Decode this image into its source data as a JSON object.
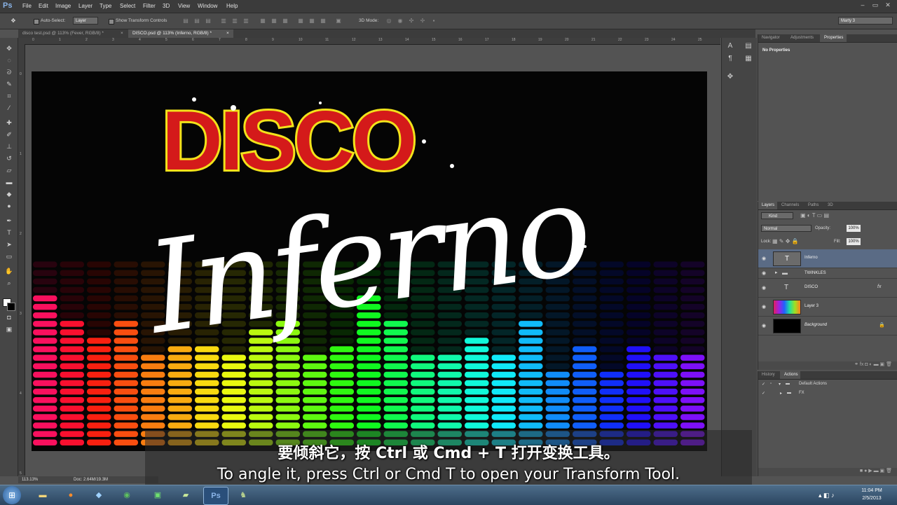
{
  "app": {
    "logo": "Ps"
  },
  "menu": [
    "File",
    "Edit",
    "Image",
    "Layer",
    "Type",
    "Select",
    "Filter",
    "3D",
    "View",
    "Window",
    "Help"
  ],
  "window_controls": [
    "–",
    "▭",
    "✕"
  ],
  "options_bar": {
    "auto_select_label": "Auto-Select:",
    "auto_select_value": "Layer",
    "show_transform_label": "Show Transform Controls",
    "mode_3d_label": "3D Mode:",
    "workspace_value": "Marty 3"
  },
  "doc_tabs": [
    {
      "label": "disco test.psd @ 113% (Fever, RGB/8) *",
      "active": false
    },
    {
      "label": "DISCO.psd @ 113% (Inferno, RGB/8) *",
      "active": true
    }
  ],
  "tab_close": "×",
  "ruler_top_ticks": [
    "0",
    "1",
    "2",
    "3",
    "4",
    "5",
    "6",
    "7",
    "8",
    "9",
    "10",
    "11",
    "12",
    "13",
    "14",
    "15",
    "16",
    "17",
    "18",
    "19",
    "20",
    "21",
    "22",
    "23",
    "24",
    "25"
  ],
  "ruler_left_ticks": [
    "0",
    "1",
    "2",
    "3",
    "4",
    "5"
  ],
  "canvas": {
    "title_word": "DISCO",
    "script_word": "Inferno",
    "colors": {
      "disco_fill": "#d41a1a",
      "disco_stroke": "#f2e21a",
      "script_fill": "#ffffff"
    }
  },
  "properties_panel": {
    "tabs": [
      "Navigator",
      "Adjustments",
      "Properties"
    ],
    "active_tab": "Properties",
    "content": "No Properties"
  },
  "layers_panel": {
    "tabs": [
      "Layers",
      "Channels",
      "Paths",
      "3D"
    ],
    "active_tab": "Layers",
    "kind_label": "Kind",
    "blend_mode": "Normal",
    "opacity_label": "Opacity:",
    "opacity_value": "100%",
    "lock_label": "Lock:",
    "fill_label": "Fill:",
    "fill_value": "100%",
    "layers": [
      {
        "name": "Inferno",
        "type": "text",
        "selected": true
      },
      {
        "name": "TWINKLES",
        "type": "group",
        "selected": false
      },
      {
        "name": "DISCO",
        "type": "text",
        "selected": false,
        "fx": true
      },
      {
        "name": "Layer 3",
        "type": "image",
        "selected": false
      },
      {
        "name": "Background",
        "type": "background",
        "selected": false,
        "locked": true
      }
    ]
  },
  "actions_panel": {
    "tabs": [
      "History",
      "Actions"
    ],
    "active_tab": "Actions",
    "items": [
      {
        "name": "Default Actions",
        "indent": 0
      },
      {
        "name": "FX",
        "indent": 0
      }
    ]
  },
  "status_bar": {
    "zoom": "113.13%",
    "doc_info": "Doc: 2.64M/19.3M"
  },
  "subtitles": {
    "chinese": "要倾斜它，按 Ctrl 或 Cmd + T 打开变换工具。",
    "english": "To angle it, press Ctrl or Cmd T to open your Transform Tool."
  },
  "taskbar": {
    "clock_time": "11:04 PM",
    "clock_date": "2/5/2013"
  },
  "icons": [
    "move-icon",
    "marquee-icon",
    "lasso-icon",
    "quick-select-icon",
    "crop-icon",
    "eyedropper-icon",
    "healing-icon",
    "brush-icon",
    "clone-stamp-icon",
    "history-brush-icon",
    "eraser-icon",
    "gradient-icon",
    "blur-icon",
    "dodge-icon",
    "pen-icon",
    "type-icon",
    "path-select-icon",
    "shape-icon",
    "hand-icon",
    "zoom-icon",
    "eye-icon",
    "folder-icon",
    "text-layer-icon",
    "lock-icon",
    "fx-icon"
  ]
}
